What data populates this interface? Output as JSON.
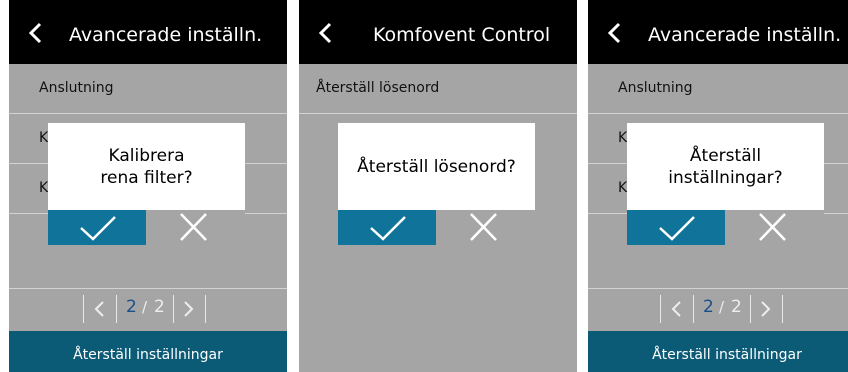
{
  "panels": [
    {
      "header_title": "Avancerade inställn.",
      "rows": [
        "Anslutning",
        "K",
        "K"
      ],
      "pager": {
        "current": "2",
        "separator": "/",
        "total": "2"
      },
      "footer": "Återställ inställningar",
      "dialog": {
        "line1": "Kalibrera",
        "line2": "rena filter?"
      }
    },
    {
      "header_title": "Komfovent Control",
      "rows": [
        "Återställ lösenord"
      ],
      "dialog": {
        "line1": "Återställ lösenord?",
        "line2": ""
      }
    },
    {
      "header_title": "Avancerade inställn.",
      "rows": [
        "Anslutning",
        "K",
        "K"
      ],
      "pager": {
        "current": "2",
        "separator": "/",
        "total": "2"
      },
      "footer": "Återställ inställningar",
      "dialog": {
        "line1": "Återställ",
        "line2": "inställningar?"
      }
    }
  ],
  "colors": {
    "header": "#000000",
    "background": "#a5a5a5",
    "accent": "#10739a",
    "footer": "#0b5a76",
    "pager_current": "#1a4f8a"
  },
  "icons": [
    "chevron-left-icon",
    "checkmark-icon",
    "close-icon",
    "chevron-right-icon"
  ]
}
